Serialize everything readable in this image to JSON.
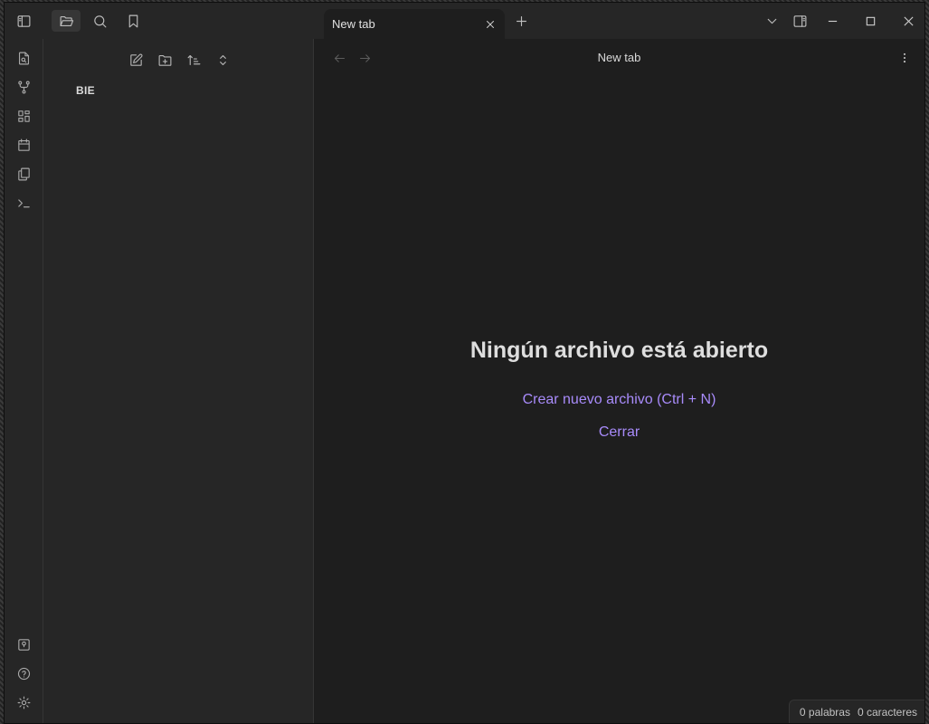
{
  "window": {
    "tab_title": "New tab"
  },
  "sidebar": {
    "vault_name": "BIE"
  },
  "main": {
    "view_title": "New tab",
    "empty_title": "Ningún archivo está abierto",
    "create_link": "Crear nuevo archivo (Ctrl + N)",
    "close_link": "Cerrar"
  },
  "status": {
    "words": "0 palabras",
    "chars": "0 caracteres"
  },
  "colors": {
    "accent": "#a88bfa",
    "editor_bg": "#1e1e1e",
    "chrome_bg": "#262626"
  }
}
